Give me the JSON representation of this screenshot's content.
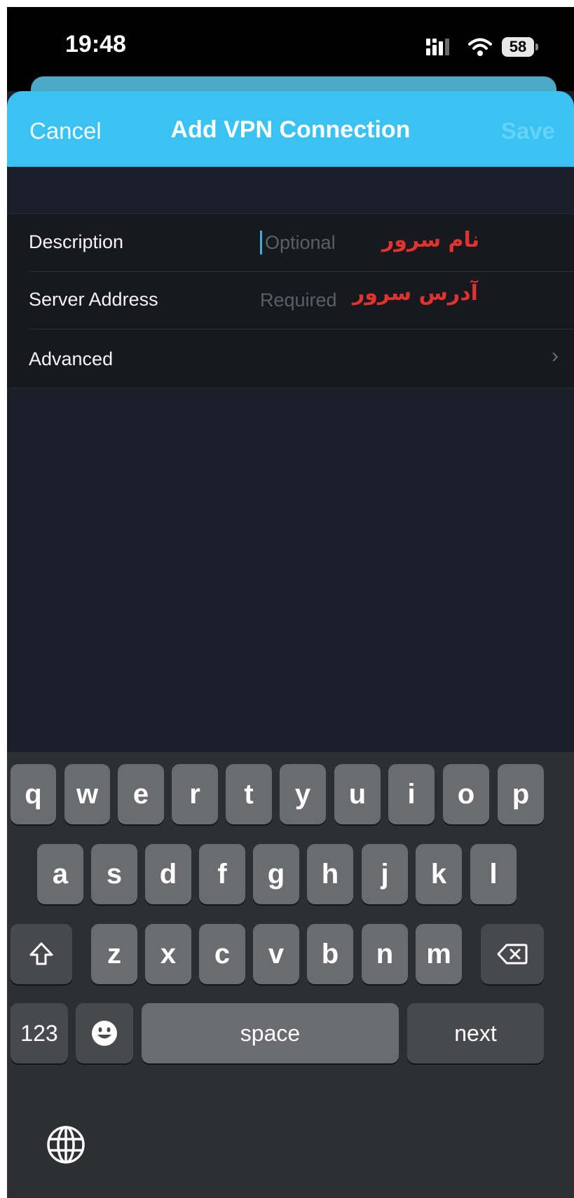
{
  "status_bar": {
    "time": "19:48",
    "battery": "58"
  },
  "nav": {
    "cancel": "Cancel",
    "title": "Add VPN Connection",
    "save": "Save"
  },
  "form": {
    "description": {
      "label": "Description",
      "placeholder": "Optional",
      "annotation": "نام سرور"
    },
    "server_address": {
      "label": "Server Address",
      "placeholder": "Required",
      "annotation": "آدرس سرور"
    },
    "advanced": {
      "label": "Advanced",
      "chevron": "›"
    }
  },
  "keyboard": {
    "row1": [
      "q",
      "w",
      "e",
      "r",
      "t",
      "y",
      "u",
      "i",
      "o",
      "p"
    ],
    "row2": [
      "a",
      "s",
      "d",
      "f",
      "g",
      "h",
      "j",
      "k",
      "l"
    ],
    "row3": [
      "z",
      "x",
      "c",
      "v",
      "b",
      "n",
      "m"
    ],
    "numbers": "123",
    "space": "space",
    "next": "next",
    "icons": {
      "shift": "shift-icon",
      "delete": "backspace-icon",
      "emoji": "emoji-icon",
      "globe": "globe-icon"
    }
  }
}
